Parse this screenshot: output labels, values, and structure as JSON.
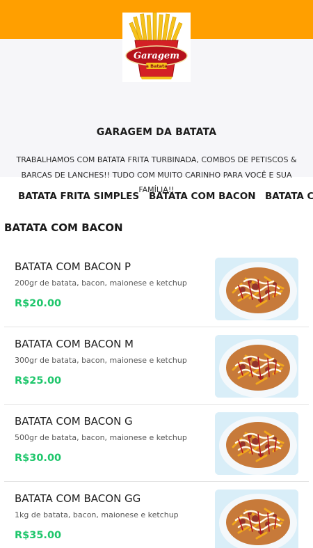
{
  "colors": {
    "topbar": "#ff9f00",
    "header_bg": "#f6f6f9",
    "price": "#1ec66b"
  },
  "store": {
    "logo_text_1": "Garagem",
    "logo_text_2": "a Batata",
    "name": "GARAGEM DA BATATA",
    "description": "TRABALHAMOS COM BATATA FRITA TURBINADA, COMBOS DE PETISCOS & BARCAS DE LANCHES!! TUDO COM MUITO CARINHO PARA VOCÊ E SUA FAMÍLIA!!"
  },
  "tabs": [
    {
      "label": "BATATA FRITA SIMPLES"
    },
    {
      "label": "BATATA COM BACON"
    },
    {
      "label": "BATATA C"
    }
  ],
  "section": {
    "title": "BATATA COM BACON"
  },
  "products": [
    {
      "name": "BATATA COM BACON P",
      "description": "200gr de batata, bacon, maionese e ketchup",
      "price": "R$20.00",
      "image_icon": "fries-bowl-photo"
    },
    {
      "name": "BATATA COM BACON M",
      "description": "300gr de batata, bacon, maionese e ketchup",
      "price": "R$25.00",
      "image_icon": "fries-bowl-photo"
    },
    {
      "name": "BATATA COM BACON G",
      "description": "500gr de batata, bacon, maionese e ketchup",
      "price": "R$30.00",
      "image_icon": "fries-bowl-photo"
    },
    {
      "name": "BATATA COM BACON GG",
      "description": "1kg de batata, bacon, maionese e ketchup",
      "price": "R$35.00",
      "image_icon": "fries-bowl-photo"
    }
  ]
}
